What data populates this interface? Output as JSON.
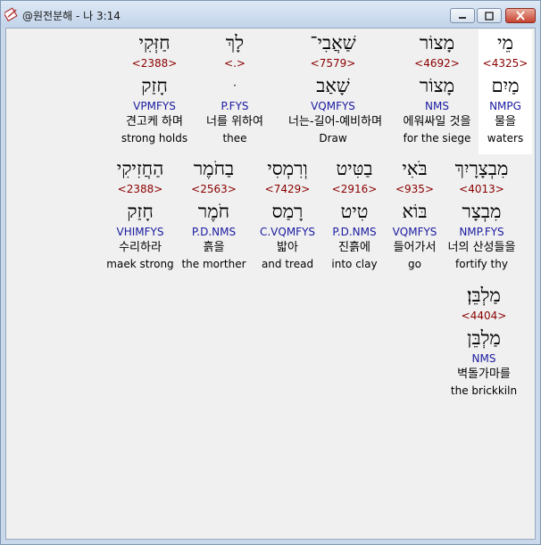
{
  "window": {
    "title": "@원전분해 - 나 3:14"
  },
  "rows": [
    [
      {
        "heb": "מֵי",
        "num": "<4325>",
        "lemma": "מַיִם",
        "parse": "NMPG",
        "kor": "물을",
        "eng": "waters",
        "highlight": true
      },
      {
        "heb": "מָצוֹר",
        "num": "<4692>",
        "lemma": "מָצוֹר",
        "parse": "NMS",
        "kor": "에워싸일 것을",
        "eng": "for the siege"
      },
      {
        "heb": "שַׁאֲבִי־",
        "num": "<7579>",
        "lemma": "שָׁאַב",
        "parse": "VQMFYS",
        "kor": "너는-길어-예비하며",
        "eng": "Draw"
      },
      {
        "heb": "לָךְ",
        "num": "<.>",
        "lemma": "ּ",
        "parse": "P.FYS",
        "kor": "너를 위하여",
        "eng": "thee"
      },
      {
        "heb": "חַזְּקִי",
        "num": "<2388>",
        "lemma": "חָזַק",
        "parse": "VPMFYS",
        "kor": "견고케 하며",
        "eng": "strong holds"
      }
    ],
    [
      {
        "heb": "מִבְצָרָיִךְ",
        "num": "<4013>",
        "lemma": "מִבְצָר",
        "parse": "NMP.FYS",
        "kor": "너의 산성들을",
        "eng": "fortify thy"
      },
      {
        "heb": "בֹּאִי",
        "num": "<935>",
        "lemma": "בּוֹא",
        "parse": "VQMFYS",
        "kor": "들어가서",
        "eng": "go"
      },
      {
        "heb": "בַטִּיט",
        "num": "<2916>",
        "lemma": "טִיט",
        "parse": "P.D.NMS",
        "kor": "진흙에",
        "eng": "into clay"
      },
      {
        "heb": "וְרִמְסִי",
        "num": "<7429>",
        "lemma": "רָמַס",
        "parse": "C.VQMFYS",
        "kor": "밟아",
        "eng": "and tread"
      },
      {
        "heb": "בַחֹמֶר",
        "num": "<2563>",
        "lemma": "חֹמֶר",
        "parse": "P.D.NMS",
        "kor": "흙을",
        "eng": "the morther"
      },
      {
        "heb": "הַחֲזִיקִי",
        "num": "<2388>",
        "lemma": "חָזַק",
        "parse": "VHIMFYS",
        "kor": "수리하라",
        "eng": "maek strong"
      }
    ],
    [
      {
        "heb": "מַלְבֵּן׃",
        "num": "<4404>",
        "lemma": "מַלְבֵּן",
        "parse": "NMS",
        "kor": "벽돌가마를",
        "eng": "the brickkiln"
      }
    ]
  ]
}
